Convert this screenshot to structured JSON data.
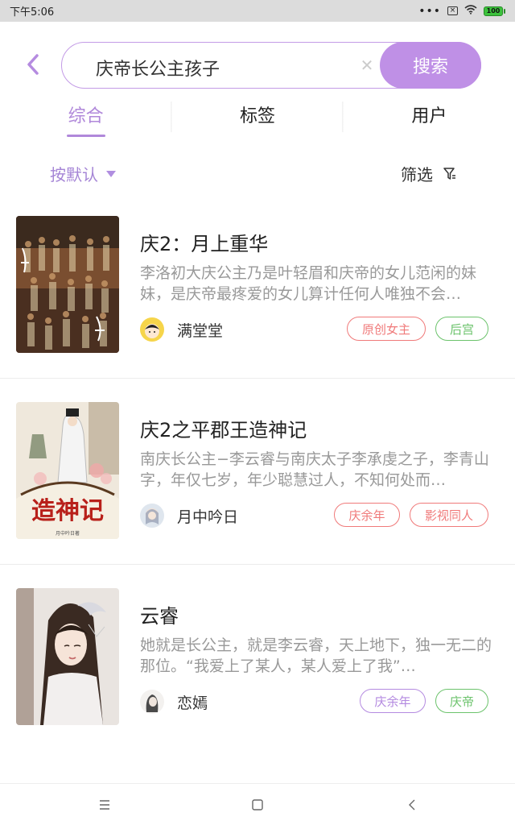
{
  "status_bar": {
    "time": "下午5:06",
    "battery": "100"
  },
  "search": {
    "query": "庆帝长公主孩子",
    "button_label": "搜索"
  },
  "tabs": [
    {
      "label": "综合",
      "active": true
    },
    {
      "label": "标签",
      "active": false
    },
    {
      "label": "用户",
      "active": false
    }
  ],
  "filters": {
    "sort_label": "按默认",
    "filter_label": "筛选"
  },
  "books": [
    {
      "title": "庆2：月上重华",
      "description": "李洛初大庆公主乃是叶轻眉和庆帝的女儿范闲的妹妹，是庆帝最疼爱的女儿算计任何人唯独不会…",
      "author": "满堂堂",
      "tags": [
        {
          "label": "原创女主",
          "color": "#f07a7a"
        },
        {
          "label": "后宫",
          "color": "#6cc36c"
        }
      ]
    },
    {
      "title": "庆2之平郡王造神记",
      "description": "南庆长公主−李云睿与南庆太子李承虔之子，李青山字，年仅七岁，年少聪慧过人，不知何处而…",
      "author": "月中吟日",
      "tags": [
        {
          "label": "庆余年",
          "color": "#f07a7a"
        },
        {
          "label": "影视同人",
          "color": "#f07a7a"
        }
      ]
    },
    {
      "title": "云睿",
      "description": "她就是长公主，就是李云睿，天上地下，独一无二的那位。“我爱上了某人，某人爱上了我”…",
      "author": "恋嫣",
      "tags": [
        {
          "label": "庆余年",
          "color": "#b48ae0"
        },
        {
          "label": "庆帝",
          "color": "#6cc36c"
        }
      ]
    }
  ],
  "accent_color": "#bf90e6"
}
